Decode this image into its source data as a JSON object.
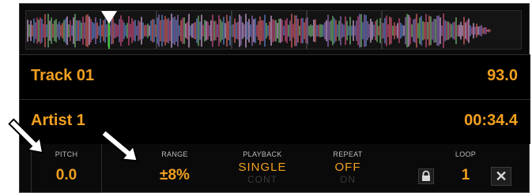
{
  "waveform": {
    "label": "waveform-overview",
    "playhead_position": 0.19
  },
  "track": {
    "title": "Track 01",
    "bpm": "93.0"
  },
  "artist": {
    "name": "Artist 1",
    "time": "00:34.4"
  },
  "controls": {
    "pitch": {
      "label": "PITCH",
      "value": "0.0"
    },
    "range": {
      "label": "RANGE",
      "value": "±8%"
    },
    "playback": {
      "label": "PLAYBACK",
      "active": "SINGLE",
      "inactive": "CONT"
    },
    "repeat": {
      "label": "REPEAT",
      "active": "OFF",
      "inactive": "ON"
    },
    "loop": {
      "label": "LOOP",
      "value": "1"
    }
  },
  "icons": {
    "lock": "lock-icon",
    "close": "close-icon",
    "arrow": "arrow-annotation"
  },
  "colors": {
    "accent": "#f2a020",
    "background": "#000000",
    "label": "#bdbdbd"
  }
}
